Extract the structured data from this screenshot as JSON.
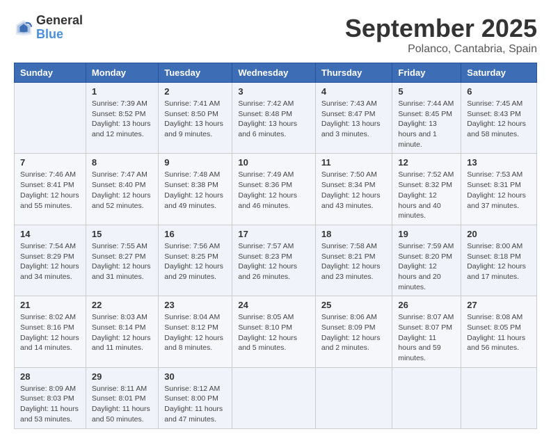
{
  "logo": {
    "text_general": "General",
    "text_blue": "Blue"
  },
  "title": "September 2025",
  "location": "Polanco, Cantabria, Spain",
  "days_of_week": [
    "Sunday",
    "Monday",
    "Tuesday",
    "Wednesday",
    "Thursday",
    "Friday",
    "Saturday"
  ],
  "weeks": [
    [
      {
        "date": "",
        "sunrise": "",
        "sunset": "",
        "daylight": ""
      },
      {
        "date": "1",
        "sunrise": "Sunrise: 7:39 AM",
        "sunset": "Sunset: 8:52 PM",
        "daylight": "Daylight: 13 hours and 12 minutes."
      },
      {
        "date": "2",
        "sunrise": "Sunrise: 7:41 AM",
        "sunset": "Sunset: 8:50 PM",
        "daylight": "Daylight: 13 hours and 9 minutes."
      },
      {
        "date": "3",
        "sunrise": "Sunrise: 7:42 AM",
        "sunset": "Sunset: 8:48 PM",
        "daylight": "Daylight: 13 hours and 6 minutes."
      },
      {
        "date": "4",
        "sunrise": "Sunrise: 7:43 AM",
        "sunset": "Sunset: 8:47 PM",
        "daylight": "Daylight: 13 hours and 3 minutes."
      },
      {
        "date": "5",
        "sunrise": "Sunrise: 7:44 AM",
        "sunset": "Sunset: 8:45 PM",
        "daylight": "Daylight: 13 hours and 1 minute."
      },
      {
        "date": "6",
        "sunrise": "Sunrise: 7:45 AM",
        "sunset": "Sunset: 8:43 PM",
        "daylight": "Daylight: 12 hours and 58 minutes."
      }
    ],
    [
      {
        "date": "7",
        "sunrise": "Sunrise: 7:46 AM",
        "sunset": "Sunset: 8:41 PM",
        "daylight": "Daylight: 12 hours and 55 minutes."
      },
      {
        "date": "8",
        "sunrise": "Sunrise: 7:47 AM",
        "sunset": "Sunset: 8:40 PM",
        "daylight": "Daylight: 12 hours and 52 minutes."
      },
      {
        "date": "9",
        "sunrise": "Sunrise: 7:48 AM",
        "sunset": "Sunset: 8:38 PM",
        "daylight": "Daylight: 12 hours and 49 minutes."
      },
      {
        "date": "10",
        "sunrise": "Sunrise: 7:49 AM",
        "sunset": "Sunset: 8:36 PM",
        "daylight": "Daylight: 12 hours and 46 minutes."
      },
      {
        "date": "11",
        "sunrise": "Sunrise: 7:50 AM",
        "sunset": "Sunset: 8:34 PM",
        "daylight": "Daylight: 12 hours and 43 minutes."
      },
      {
        "date": "12",
        "sunrise": "Sunrise: 7:52 AM",
        "sunset": "Sunset: 8:32 PM",
        "daylight": "Daylight: 12 hours and 40 minutes."
      },
      {
        "date": "13",
        "sunrise": "Sunrise: 7:53 AM",
        "sunset": "Sunset: 8:31 PM",
        "daylight": "Daylight: 12 hours and 37 minutes."
      }
    ],
    [
      {
        "date": "14",
        "sunrise": "Sunrise: 7:54 AM",
        "sunset": "Sunset: 8:29 PM",
        "daylight": "Daylight: 12 hours and 34 minutes."
      },
      {
        "date": "15",
        "sunrise": "Sunrise: 7:55 AM",
        "sunset": "Sunset: 8:27 PM",
        "daylight": "Daylight: 12 hours and 31 minutes."
      },
      {
        "date": "16",
        "sunrise": "Sunrise: 7:56 AM",
        "sunset": "Sunset: 8:25 PM",
        "daylight": "Daylight: 12 hours and 29 minutes."
      },
      {
        "date": "17",
        "sunrise": "Sunrise: 7:57 AM",
        "sunset": "Sunset: 8:23 PM",
        "daylight": "Daylight: 12 hours and 26 minutes."
      },
      {
        "date": "18",
        "sunrise": "Sunrise: 7:58 AM",
        "sunset": "Sunset: 8:21 PM",
        "daylight": "Daylight: 12 hours and 23 minutes."
      },
      {
        "date": "19",
        "sunrise": "Sunrise: 7:59 AM",
        "sunset": "Sunset: 8:20 PM",
        "daylight": "Daylight: 12 hours and 20 minutes."
      },
      {
        "date": "20",
        "sunrise": "Sunrise: 8:00 AM",
        "sunset": "Sunset: 8:18 PM",
        "daylight": "Daylight: 12 hours and 17 minutes."
      }
    ],
    [
      {
        "date": "21",
        "sunrise": "Sunrise: 8:02 AM",
        "sunset": "Sunset: 8:16 PM",
        "daylight": "Daylight: 12 hours and 14 minutes."
      },
      {
        "date": "22",
        "sunrise": "Sunrise: 8:03 AM",
        "sunset": "Sunset: 8:14 PM",
        "daylight": "Daylight: 12 hours and 11 minutes."
      },
      {
        "date": "23",
        "sunrise": "Sunrise: 8:04 AM",
        "sunset": "Sunset: 8:12 PM",
        "daylight": "Daylight: 12 hours and 8 minutes."
      },
      {
        "date": "24",
        "sunrise": "Sunrise: 8:05 AM",
        "sunset": "Sunset: 8:10 PM",
        "daylight": "Daylight: 12 hours and 5 minutes."
      },
      {
        "date": "25",
        "sunrise": "Sunrise: 8:06 AM",
        "sunset": "Sunset: 8:09 PM",
        "daylight": "Daylight: 12 hours and 2 minutes."
      },
      {
        "date": "26",
        "sunrise": "Sunrise: 8:07 AM",
        "sunset": "Sunset: 8:07 PM",
        "daylight": "Daylight: 11 hours and 59 minutes."
      },
      {
        "date": "27",
        "sunrise": "Sunrise: 8:08 AM",
        "sunset": "Sunset: 8:05 PM",
        "daylight": "Daylight: 11 hours and 56 minutes."
      }
    ],
    [
      {
        "date": "28",
        "sunrise": "Sunrise: 8:09 AM",
        "sunset": "Sunset: 8:03 PM",
        "daylight": "Daylight: 11 hours and 53 minutes."
      },
      {
        "date": "29",
        "sunrise": "Sunrise: 8:11 AM",
        "sunset": "Sunset: 8:01 PM",
        "daylight": "Daylight: 11 hours and 50 minutes."
      },
      {
        "date": "30",
        "sunrise": "Sunrise: 8:12 AM",
        "sunset": "Sunset: 8:00 PM",
        "daylight": "Daylight: 11 hours and 47 minutes."
      },
      {
        "date": "",
        "sunrise": "",
        "sunset": "",
        "daylight": ""
      },
      {
        "date": "",
        "sunrise": "",
        "sunset": "",
        "daylight": ""
      },
      {
        "date": "",
        "sunrise": "",
        "sunset": "",
        "daylight": ""
      },
      {
        "date": "",
        "sunrise": "",
        "sunset": "",
        "daylight": ""
      }
    ]
  ]
}
